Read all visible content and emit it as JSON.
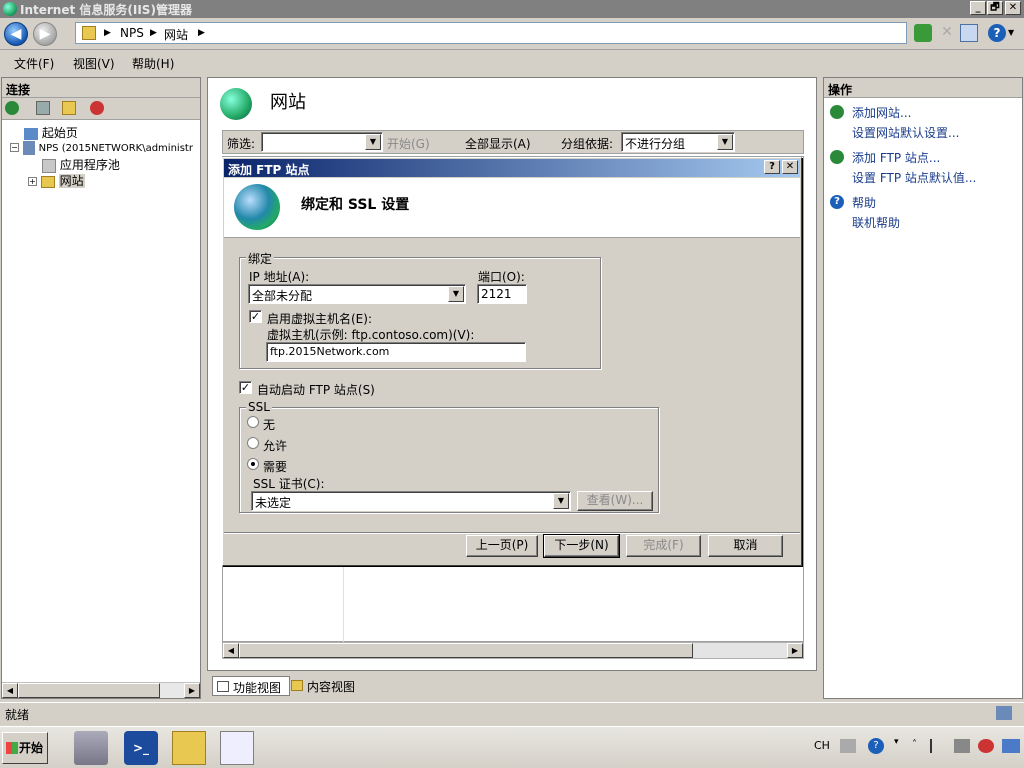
{
  "window": {
    "title": "Internet 信息服务(IIS)管理器",
    "controls": [
      "_",
      "🗗",
      "✕"
    ]
  },
  "address": {
    "crumbs": [
      "NPS",
      "网站"
    ]
  },
  "menu": {
    "items": [
      "文件(F)",
      "视图(V)",
      "帮助(H)"
    ]
  },
  "connections": {
    "header": "连接",
    "tree": [
      {
        "label": "起始页",
        "level": 1
      },
      {
        "label": "NPS (2015NETWORK\\administr",
        "level": 1
      },
      {
        "label": "应用程序池",
        "level": 2
      },
      {
        "label": "网站",
        "level": 2
      }
    ]
  },
  "center": {
    "title": "网站",
    "filter_label": "筛选:",
    "start_label": "开始(G)",
    "show_all_label": "全部显示(A)",
    "group_label": "分组依据:",
    "group_value": "不进行分组"
  },
  "view_tabs": {
    "features": "功能视图",
    "content": "内容视图"
  },
  "actions": {
    "header": "操作",
    "items": [
      {
        "label": "添加网站..."
      },
      {
        "label": "设置网站默认设置..."
      },
      {
        "label": "添加 FTP 站点..."
      },
      {
        "label": "设置 FTP 站点默认值..."
      },
      {
        "label": "帮助"
      },
      {
        "label": "联机帮助"
      }
    ]
  },
  "status": {
    "text": "就绪"
  },
  "taskbar": {
    "start": "开始",
    "lang": "CH"
  },
  "dialog": {
    "title": "添加 FTP 站点",
    "help_btn": "?",
    "close_btn": "✕",
    "heading": "绑定和 SSL 设置",
    "binding_group": "绑定",
    "ip_label": "IP 地址(A):",
    "ip_value": "全部未分配",
    "port_label": "端口(O):",
    "port_value": "2121",
    "vhost_check_label": "启用虚拟主机名(E):",
    "vhost_checked": true,
    "vhost_label": "虚拟主机(示例: ftp.contoso.com)(V):",
    "vhost_value": "ftp.2015Network.com",
    "autostart_label": "自动启动 FTP 站点(S)",
    "autostart_checked": true,
    "ssl_group": "SSL",
    "ssl_options": [
      "无",
      "允许",
      "需要"
    ],
    "ssl_selected": 2,
    "cert_label": "SSL 证书(C):",
    "cert_value": "未选定",
    "view_btn": "查看(W)...",
    "prev_btn": "上一页(P)",
    "next_btn": "下一步(N)",
    "finish_btn": "完成(F)",
    "cancel_btn": "取消"
  }
}
